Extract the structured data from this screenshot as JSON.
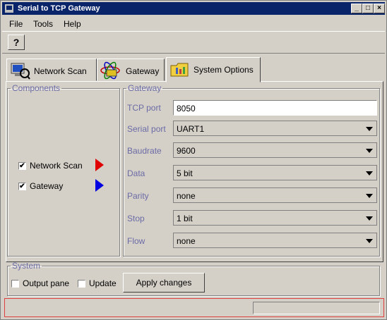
{
  "window": {
    "title": "Serial to TCP Gateway",
    "controls": [
      "_",
      "□",
      "×"
    ]
  },
  "menu": [
    "File",
    "Tools",
    "Help"
  ],
  "toolbar": {
    "help_label": "?"
  },
  "tabs": [
    {
      "label": "Network Scan",
      "icon": "network-scan-icon"
    },
    {
      "label": "Gateway",
      "icon": "gateway-atom-icon"
    },
    {
      "label": "System Options",
      "icon": "system-options-folder-icon",
      "selected": true
    }
  ],
  "components": {
    "legend": "Components",
    "items": [
      {
        "label": "Network Scan",
        "checked": true,
        "color": "#e00000"
      },
      {
        "label": "Gateway",
        "checked": true,
        "color": "#0000e0"
      }
    ]
  },
  "gateway": {
    "legend": "Gateway",
    "fields": [
      {
        "label": "TCP port",
        "value": "8050",
        "kind": "text"
      },
      {
        "label": "Serial port",
        "value": "UART1",
        "kind": "combo"
      },
      {
        "label": "Baudrate",
        "value": "9600",
        "kind": "combo"
      },
      {
        "label": "Data",
        "value": "5 bit",
        "kind": "combo"
      },
      {
        "label": "Parity",
        "value": "none",
        "kind": "combo"
      },
      {
        "label": "Stop",
        "value": "1 bit",
        "kind": "combo"
      },
      {
        "label": "Flow",
        "value": "none",
        "kind": "combo"
      }
    ]
  },
  "system": {
    "legend": "System",
    "output_pane": "Output pane",
    "update": "Update",
    "apply": "Apply changes"
  }
}
